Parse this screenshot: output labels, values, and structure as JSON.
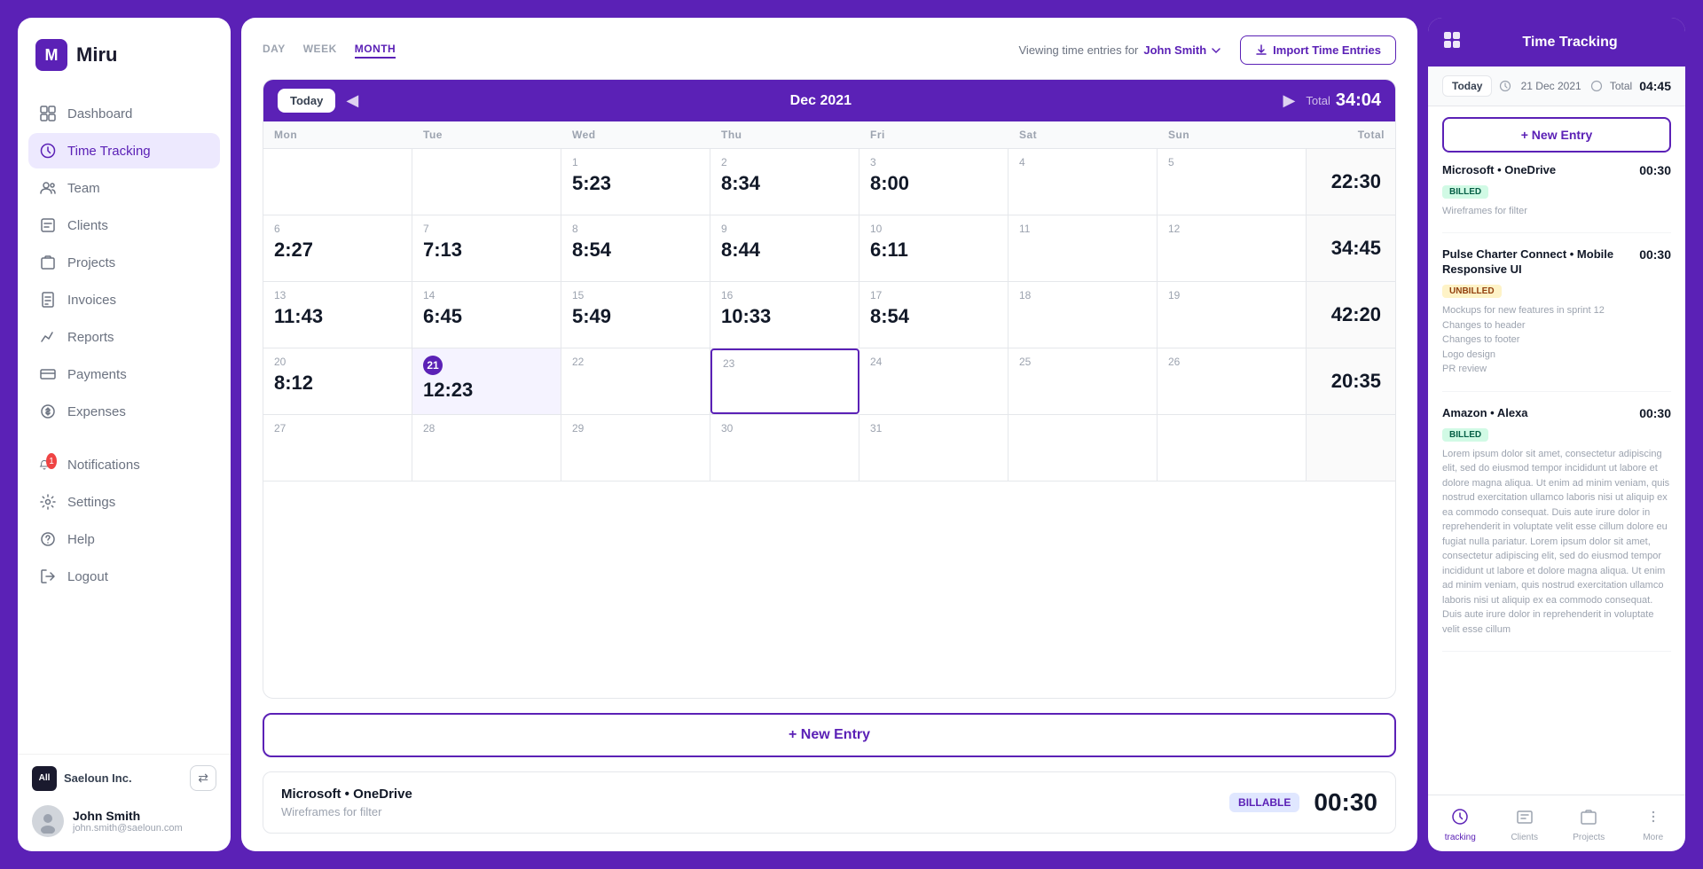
{
  "app": {
    "name": "Miru",
    "logo_letter": "M"
  },
  "sidebar": {
    "nav_items": [
      {
        "id": "dashboard",
        "label": "Dashboard",
        "icon": "⊞",
        "active": false
      },
      {
        "id": "time-tracking",
        "label": "Time Tracking",
        "icon": "○",
        "active": true
      },
      {
        "id": "team",
        "label": "Team",
        "icon": "☻",
        "active": false
      },
      {
        "id": "clients",
        "label": "Clients",
        "icon": "◻",
        "active": false
      },
      {
        "id": "projects",
        "label": "Projects",
        "icon": "◫",
        "active": false
      },
      {
        "id": "invoices",
        "label": "Invoices",
        "icon": "▤",
        "active": false
      },
      {
        "id": "reports",
        "label": "Reports",
        "icon": "↗",
        "active": false
      },
      {
        "id": "payments",
        "label": "Payments",
        "icon": "◻",
        "active": false
      },
      {
        "id": "expenses",
        "label": "Expenses",
        "icon": "◻",
        "active": false
      }
    ],
    "bottom_nav": [
      {
        "id": "notifications",
        "label": "Notifications",
        "icon": "🔔",
        "badge": "1"
      },
      {
        "id": "settings",
        "label": "Settings",
        "icon": "⚙"
      },
      {
        "id": "help",
        "label": "Help",
        "icon": "?"
      },
      {
        "id": "logout",
        "label": "Logout",
        "icon": "→"
      }
    ],
    "company": {
      "name": "Saeloun Inc.",
      "avatar": "All"
    },
    "user": {
      "name": "John Smith",
      "email": "john.smith@saeloun.com"
    },
    "switch_button_label": "⇄"
  },
  "main": {
    "view_tabs": [
      {
        "label": "DAY",
        "active": false
      },
      {
        "label": "WEEK",
        "active": false
      },
      {
        "label": "MONTH",
        "active": true
      }
    ],
    "viewing_label": "Viewing time entries for",
    "user_selector": "John Smith",
    "import_button": "Import Time Entries",
    "calendar": {
      "month": "Dec 2021",
      "total_label": "Total",
      "total_time": "34:04",
      "day_headers": [
        "Mon",
        "Tue",
        "Wed",
        "Thu",
        "Fri",
        "Sat",
        "Sun",
        "Total"
      ],
      "weeks": [
        {
          "cells": [
            {
              "date": "",
              "time": ""
            },
            {
              "date": "",
              "time": ""
            },
            {
              "date": "1",
              "time": "5:23"
            },
            {
              "date": "2",
              "time": "8:34"
            },
            {
              "date": "3",
              "time": "8:00"
            },
            {
              "date": "4",
              "time": ""
            },
            {
              "date": "5",
              "time": ""
            }
          ],
          "total": "22:30"
        },
        {
          "cells": [
            {
              "date": "6",
              "time": "2:27"
            },
            {
              "date": "7",
              "time": "7:13"
            },
            {
              "date": "8",
              "time": "8:54"
            },
            {
              "date": "9",
              "time": "8:44"
            },
            {
              "date": "10",
              "time": "6:11"
            },
            {
              "date": "11",
              "time": ""
            },
            {
              "date": "12",
              "time": ""
            }
          ],
          "total": "34:45"
        },
        {
          "cells": [
            {
              "date": "13",
              "time": "11:43"
            },
            {
              "date": "14",
              "time": "6:45"
            },
            {
              "date": "15",
              "time": "5:49"
            },
            {
              "date": "16",
              "time": "10:33"
            },
            {
              "date": "17",
              "time": "8:54"
            },
            {
              "date": "18",
              "time": ""
            },
            {
              "date": "19",
              "time": ""
            }
          ],
          "total": "42:20"
        },
        {
          "cells": [
            {
              "date": "20",
              "time": "8:12"
            },
            {
              "date": "21",
              "time": "12:23",
              "today": true
            },
            {
              "date": "22",
              "time": ""
            },
            {
              "date": "23",
              "time": "",
              "selected": true
            },
            {
              "date": "24",
              "time": ""
            },
            {
              "date": "25",
              "time": ""
            },
            {
              "date": "26",
              "time": ""
            }
          ],
          "total": "20:35"
        },
        {
          "cells": [
            {
              "date": "27",
              "time": ""
            },
            {
              "date": "28",
              "time": ""
            },
            {
              "date": "29",
              "time": ""
            },
            {
              "date": "30",
              "time": ""
            },
            {
              "date": "31",
              "time": ""
            },
            {
              "date": "",
              "time": ""
            },
            {
              "date": "",
              "time": ""
            }
          ],
          "total": ""
        }
      ]
    },
    "new_entry_button": "+ New Entry",
    "entry_card": {
      "title": "Microsoft • OneDrive",
      "description": "Wireframes for filter",
      "badge": "BILLABLE",
      "time": "00:30"
    }
  },
  "right_panel": {
    "title": "Time Tracking",
    "today_btn": "Today",
    "date": "21 Dec 2021",
    "total_label": "Total",
    "total_time": "04:45",
    "new_entry_button": "+ New Entry",
    "entries": [
      {
        "client": "Microsoft",
        "project": "OneDrive",
        "badge": "BILLED",
        "badge_type": "billed",
        "description": "Wireframes for filter",
        "time": "00:30"
      },
      {
        "client": "Pulse Charter Connect",
        "project": "Mobile Responsive UI",
        "badge": "UNBILLED",
        "badge_type": "unbilled",
        "description": "Mockups for new features in sprint 12\nChanges to header\nChanges to footer\nLogo design\nPR review",
        "time": "00:30"
      },
      {
        "client": "Amazon",
        "project": "Alexa",
        "badge": "BILLED",
        "badge_type": "billed",
        "description": "Lorem ipsum dolor sit amet, consectetur adipiscing elit, sed do eiusmod tempor incididunt ut labore et dolore magna aliqua. Ut enim ad minim veniam, quis nostrud exercitation ullamco laboris nisi ut aliquip ex ea commodo consequat. Duis aute irure dolor in reprehenderit in voluptate velit esse cillum dolore eu fugiat nulla pariatur. Lorem ipsum dolor sit amet, consectetur adipiscing elit, sed do eiusmod tempor incididunt ut labore et dolore magna aliqua. Ut enim ad minim veniam, quis nostrud exercitation ullamco laboris nisi ut aliquip ex ea commodo consequat. Duis aute irure dolor in reprehenderit in voluptate velit esse cillum",
        "time": "00:30"
      }
    ],
    "bottom_nav": [
      {
        "id": "time-tracking",
        "label": "tracking",
        "icon": "⏱",
        "active": true
      },
      {
        "id": "clients",
        "label": "Clients",
        "icon": "👥",
        "active": false
      },
      {
        "id": "projects",
        "label": "Projects",
        "icon": "📁",
        "active": false
      },
      {
        "id": "more",
        "label": "More",
        "icon": "⋮",
        "active": false
      }
    ]
  }
}
